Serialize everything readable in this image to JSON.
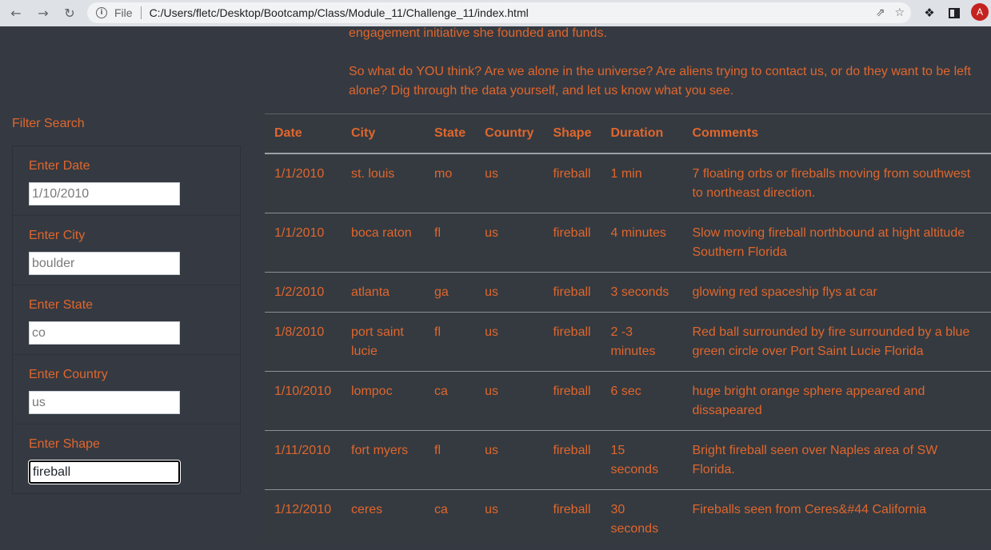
{
  "browser": {
    "scheme_label": "File",
    "url": "C:/Users/fletc/Desktop/Bootcamp/Class/Module_11/Challenge_11/index.html",
    "avatar_letter": "A"
  },
  "intro": {
    "paragraph1_tail": "engagement initiative she founded and funds.",
    "paragraph2": "So what do YOU think? Are we alone in the universe? Are aliens trying to contact us, or do they want to be left alone? Dig through the data yourself, and let us know what you see."
  },
  "filters": {
    "title": "Filter Search",
    "items": [
      {
        "label": "Enter Date",
        "placeholder": "1/10/2010",
        "value": ""
      },
      {
        "label": "Enter City",
        "placeholder": "boulder",
        "value": ""
      },
      {
        "label": "Enter State",
        "placeholder": "co",
        "value": ""
      },
      {
        "label": "Enter Country",
        "placeholder": "us",
        "value": ""
      },
      {
        "label": "Enter Shape",
        "placeholder": "",
        "value": "fireball"
      }
    ]
  },
  "table": {
    "headers": [
      "Date",
      "City",
      "State",
      "Country",
      "Shape",
      "Duration",
      "Comments"
    ],
    "rows": [
      [
        "1/1/2010",
        "st. louis",
        "mo",
        "us",
        "fireball",
        "1 min",
        "7 floating orbs or fireballs moving from southwest to northeast direction."
      ],
      [
        "1/1/2010",
        "boca raton",
        "fl",
        "us",
        "fireball",
        "4 minutes",
        "Slow moving fireball northbound at hight altitude Southern Florida"
      ],
      [
        "1/2/2010",
        "atlanta",
        "ga",
        "us",
        "fireball",
        "3 seconds",
        "glowing red spaceship flys at car"
      ],
      [
        "1/8/2010",
        "port saint lucie",
        "fl",
        "us",
        "fireball",
        "2 -3 minutes",
        "Red ball surrounded by fire surrounded by a blue green circle over Port Saint Lucie Florida"
      ],
      [
        "1/10/2010",
        "lompoc",
        "ca",
        "us",
        "fireball",
        "6 sec",
        "huge bright orange sphere appeared and dissapeared"
      ],
      [
        "1/11/2010",
        "fort myers",
        "fl",
        "us",
        "fireball",
        "15 seconds",
        "Bright fireball seen over Naples area of SW Florida."
      ],
      [
        "1/12/2010",
        "ceres",
        "ca",
        "us",
        "fireball",
        "30 seconds",
        "Fireballs seen from Ceres&#44 California"
      ]
    ]
  },
  "colors": {
    "accent": "#e0662d",
    "background": "#353a42"
  }
}
